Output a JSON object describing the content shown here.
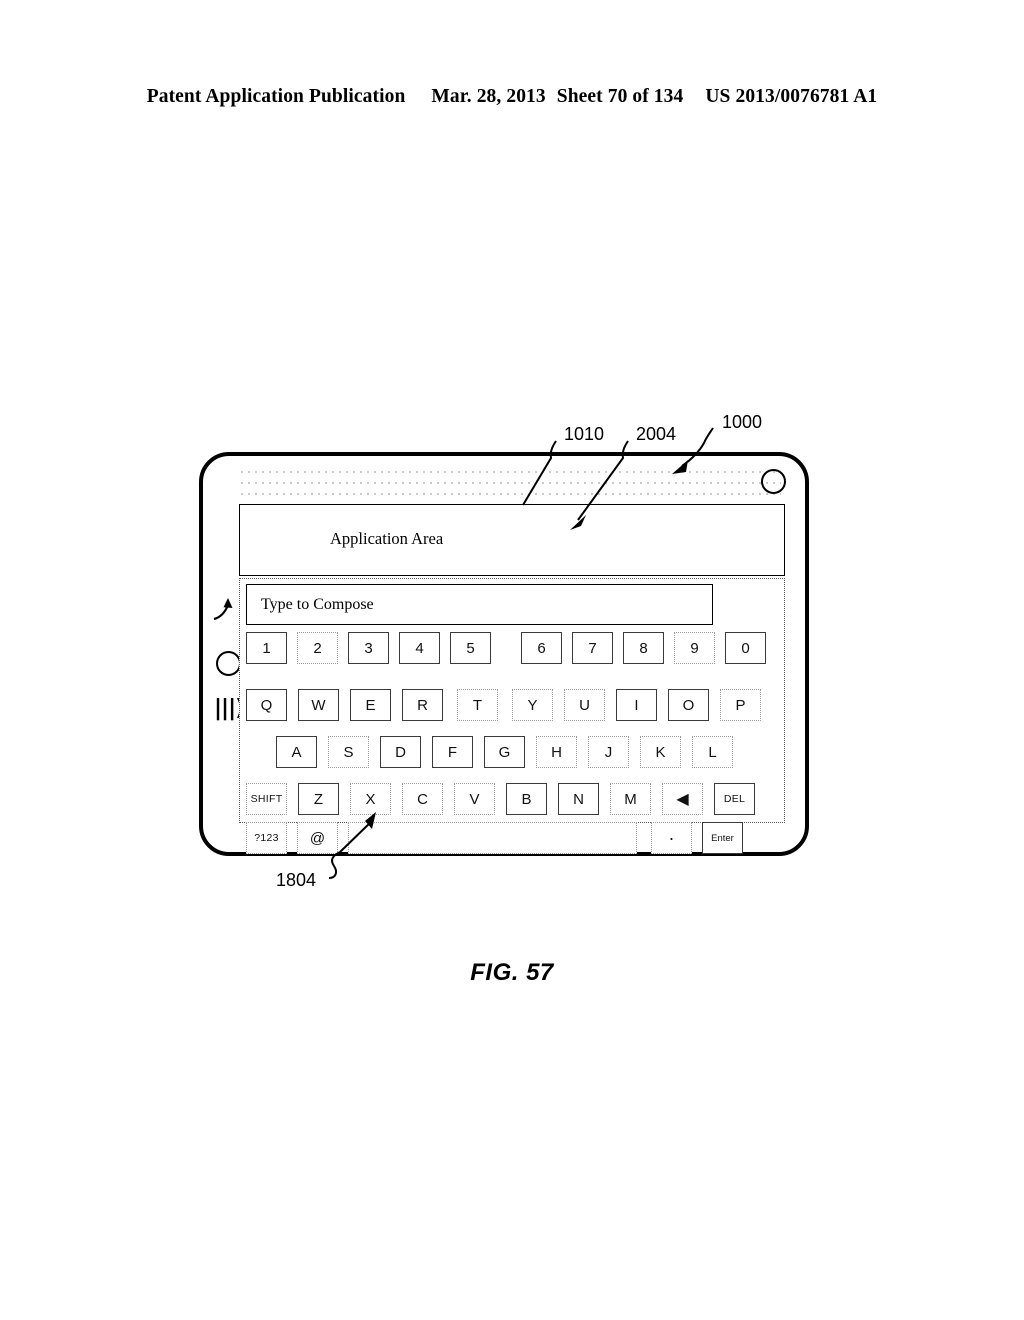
{
  "header": {
    "publication": "Patent Application Publication",
    "date": "Mar. 28, 2013",
    "sheet": "Sheet 70 of 134",
    "pub_number": "US 2013/0076781 A1"
  },
  "figure": {
    "caption": "FIG. 57"
  },
  "device": {
    "camera_icon": "camera-circle",
    "home_button_icon": "home-button-circle",
    "speaker_icon": "|||)",
    "speaker_glyph": "speaker-icon"
  },
  "screen": {
    "application_area": {
      "label": "Application Area",
      "ref": "1010"
    },
    "compose_field": {
      "value": "",
      "placeholder": "Type to Compose"
    },
    "keyboard": {
      "ref": "2004",
      "spacebar_ref": "1804",
      "rows": [
        {
          "name": "number-row",
          "keys": [
            {
              "label": "1",
              "style": "solidish"
            },
            {
              "label": "2",
              "style": "faint"
            },
            {
              "label": "3",
              "style": "solidish"
            },
            {
              "label": "4",
              "style": "solidish"
            },
            {
              "label": "5",
              "style": "solidish"
            },
            {
              "label": "6",
              "style": "solidish"
            },
            {
              "label": "7",
              "style": "solidish"
            },
            {
              "label": "8",
              "style": "solidish"
            },
            {
              "label": "9",
              "style": "faint"
            },
            {
              "label": "0",
              "style": "solidish"
            }
          ]
        },
        {
          "name": "qwerty-row",
          "keys": [
            {
              "label": "Q",
              "style": "solidish"
            },
            {
              "label": "W",
              "style": "solidish"
            },
            {
              "label": "E",
              "style": "solidish"
            },
            {
              "label": "R",
              "style": "solidish"
            },
            {
              "label": "T",
              "style": "faint"
            },
            {
              "label": "Y",
              "style": "faint"
            },
            {
              "label": "U",
              "style": "faint"
            },
            {
              "label": "I",
              "style": "solidish"
            },
            {
              "label": "O",
              "style": "solidish"
            },
            {
              "label": "P",
              "style": "faint"
            }
          ]
        },
        {
          "name": "home-row",
          "keys": [
            {
              "label": "A",
              "style": "solidish"
            },
            {
              "label": "S",
              "style": "faint"
            },
            {
              "label": "D",
              "style": "solidish"
            },
            {
              "label": "F",
              "style": "solidish"
            },
            {
              "label": "G",
              "style": "solidish"
            },
            {
              "label": "H",
              "style": "faint"
            },
            {
              "label": "J",
              "style": "faint"
            },
            {
              "label": "K",
              "style": "faint"
            },
            {
              "label": "L",
              "style": "faint"
            }
          ]
        },
        {
          "name": "shift-row",
          "keys": [
            {
              "label": "SHIFT",
              "style": "faint"
            },
            {
              "label": "Z",
              "style": "solidish"
            },
            {
              "label": "X",
              "style": "faint"
            },
            {
              "label": "C",
              "style": "faint"
            },
            {
              "label": "V",
              "style": "faint"
            },
            {
              "label": "B",
              "style": "solidish"
            },
            {
              "label": "N",
              "style": "solidish"
            },
            {
              "label": "M",
              "style": "faint"
            },
            {
              "label": "◀",
              "style": "faint"
            },
            {
              "label": "DEL",
              "style": "solidish"
            }
          ]
        },
        {
          "name": "bottom-row",
          "keys": [
            {
              "label": "?123",
              "style": "faint"
            },
            {
              "label": "@",
              "style": "faint"
            },
            {
              "label": "",
              "style": "faint"
            },
            {
              "label": "·",
              "style": "faint"
            },
            {
              "label": "Enter",
              "style": "solidish"
            }
          ]
        }
      ]
    }
  },
  "callouts": [
    {
      "ref": "1010",
      "name": "callout-1010"
    },
    {
      "ref": "2004",
      "name": "callout-2004"
    },
    {
      "ref": "1000",
      "name": "callout-1000"
    },
    {
      "ref": "1804",
      "name": "callout-1804"
    }
  ]
}
